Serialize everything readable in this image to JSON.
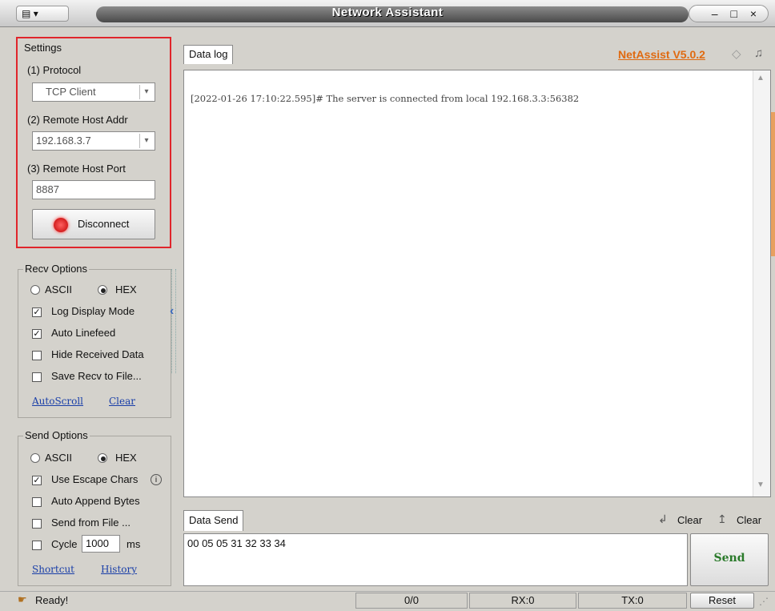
{
  "window": {
    "title": "Network Assistant",
    "app_menu_label": "▾",
    "controls": "– □ ×"
  },
  "settings": {
    "group_title": "Settings",
    "protocol_label": "(1) Protocol",
    "protocol_value": "TCP Client",
    "host_label": "(2) Remote Host Addr",
    "host_value": "192.168.3.7",
    "port_label": "(3) Remote Host Port",
    "port_value": "8887",
    "disconnect_label": "Disconnect",
    "highlight_color": "#e0252b"
  },
  "recv_options": {
    "group_title": "Recv Options",
    "ascii_label": "ASCII",
    "hex_label": "HEX",
    "selected": "HEX",
    "log_display_label": "Log Display Mode",
    "log_display_checked": true,
    "auto_linefeed_label": "Auto Linefeed",
    "auto_linefeed_checked": true,
    "hide_received_label": "Hide Received Data",
    "hide_received_checked": false,
    "save_recv_label": "Save Recv to File...",
    "save_recv_checked": false,
    "autoscroll_link": "AutoScroll",
    "clear_link": "Clear"
  },
  "send_options": {
    "group_title": "Send Options",
    "ascii_label": "ASCII",
    "hex_label": "HEX",
    "selected": "HEX",
    "escape_label": "Use Escape Chars",
    "escape_checked": true,
    "auto_append_label": "Auto Append Bytes",
    "auto_append_checked": false,
    "send_file_label": "Send from File ...",
    "send_file_checked": false,
    "cycle_label": "Cycle",
    "cycle_value": "1000",
    "cycle_unit": "ms",
    "cycle_checked": false,
    "shortcut_link": "Shortcut",
    "history_link": "History"
  },
  "data_log": {
    "tab_label": "Data log",
    "brand": "NetAssist V5.0.2",
    "brand_color": "#e06a10",
    "log_line": "[2022-01-26 17:10:22.595]# The server is connected from local 192.168.3.3:56382"
  },
  "data_send": {
    "tab_label": "Data Send",
    "clear1_label": "Clear",
    "clear2_label": "Clear",
    "input_value": "00 05 05 31 32 33 34",
    "send_label": "Send",
    "send_color": "#2a7a2a"
  },
  "status": {
    "ready": "Ready!",
    "counter": "0/0",
    "rx": "RX:0",
    "tx": "TX:0",
    "reset_label": "Reset"
  }
}
